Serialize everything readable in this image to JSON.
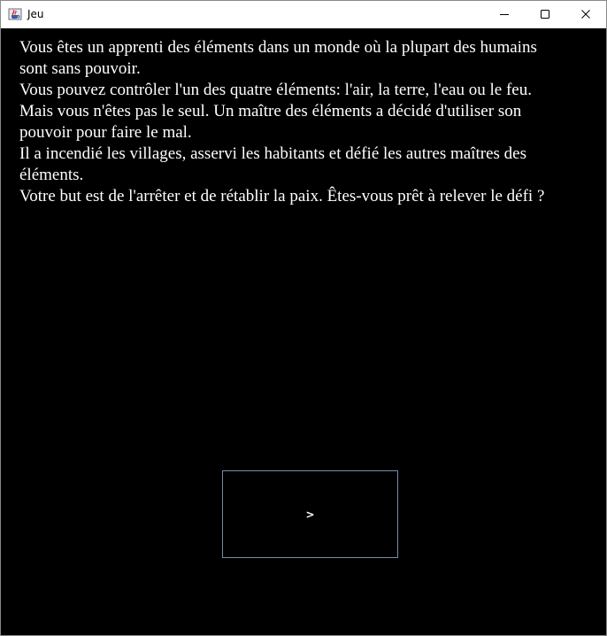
{
  "window": {
    "title": "Jeu",
    "app_icon": "java-cup-icon",
    "controls": [
      "minimize-icon",
      "maximize-icon",
      "close-icon"
    ]
  },
  "story": {
    "text": "Vous êtes un apprenti des éléments dans un monde où la plupart des humains sont sans pouvoir.\nVous pouvez contrôler l'un des quatre éléments: l'air, la terre, l'eau ou le feu.\nMais vous n'êtes pas le seul. Un maître des éléments a décidé d'utiliser son pouvoir pour faire le mal.\nIl a incendié les villages, asservi les habitants et défié les autres maîtres des éléments.\nVotre but est de l'arrêter et de rétablir la paix. Êtes-vous prêt à relever le défi ?"
  },
  "next_button": {
    "label": ">"
  },
  "colors": {
    "background": "#000000",
    "text": "#ffffff",
    "button_border": "#7a8aa8",
    "titlebar": "#ffffff"
  }
}
